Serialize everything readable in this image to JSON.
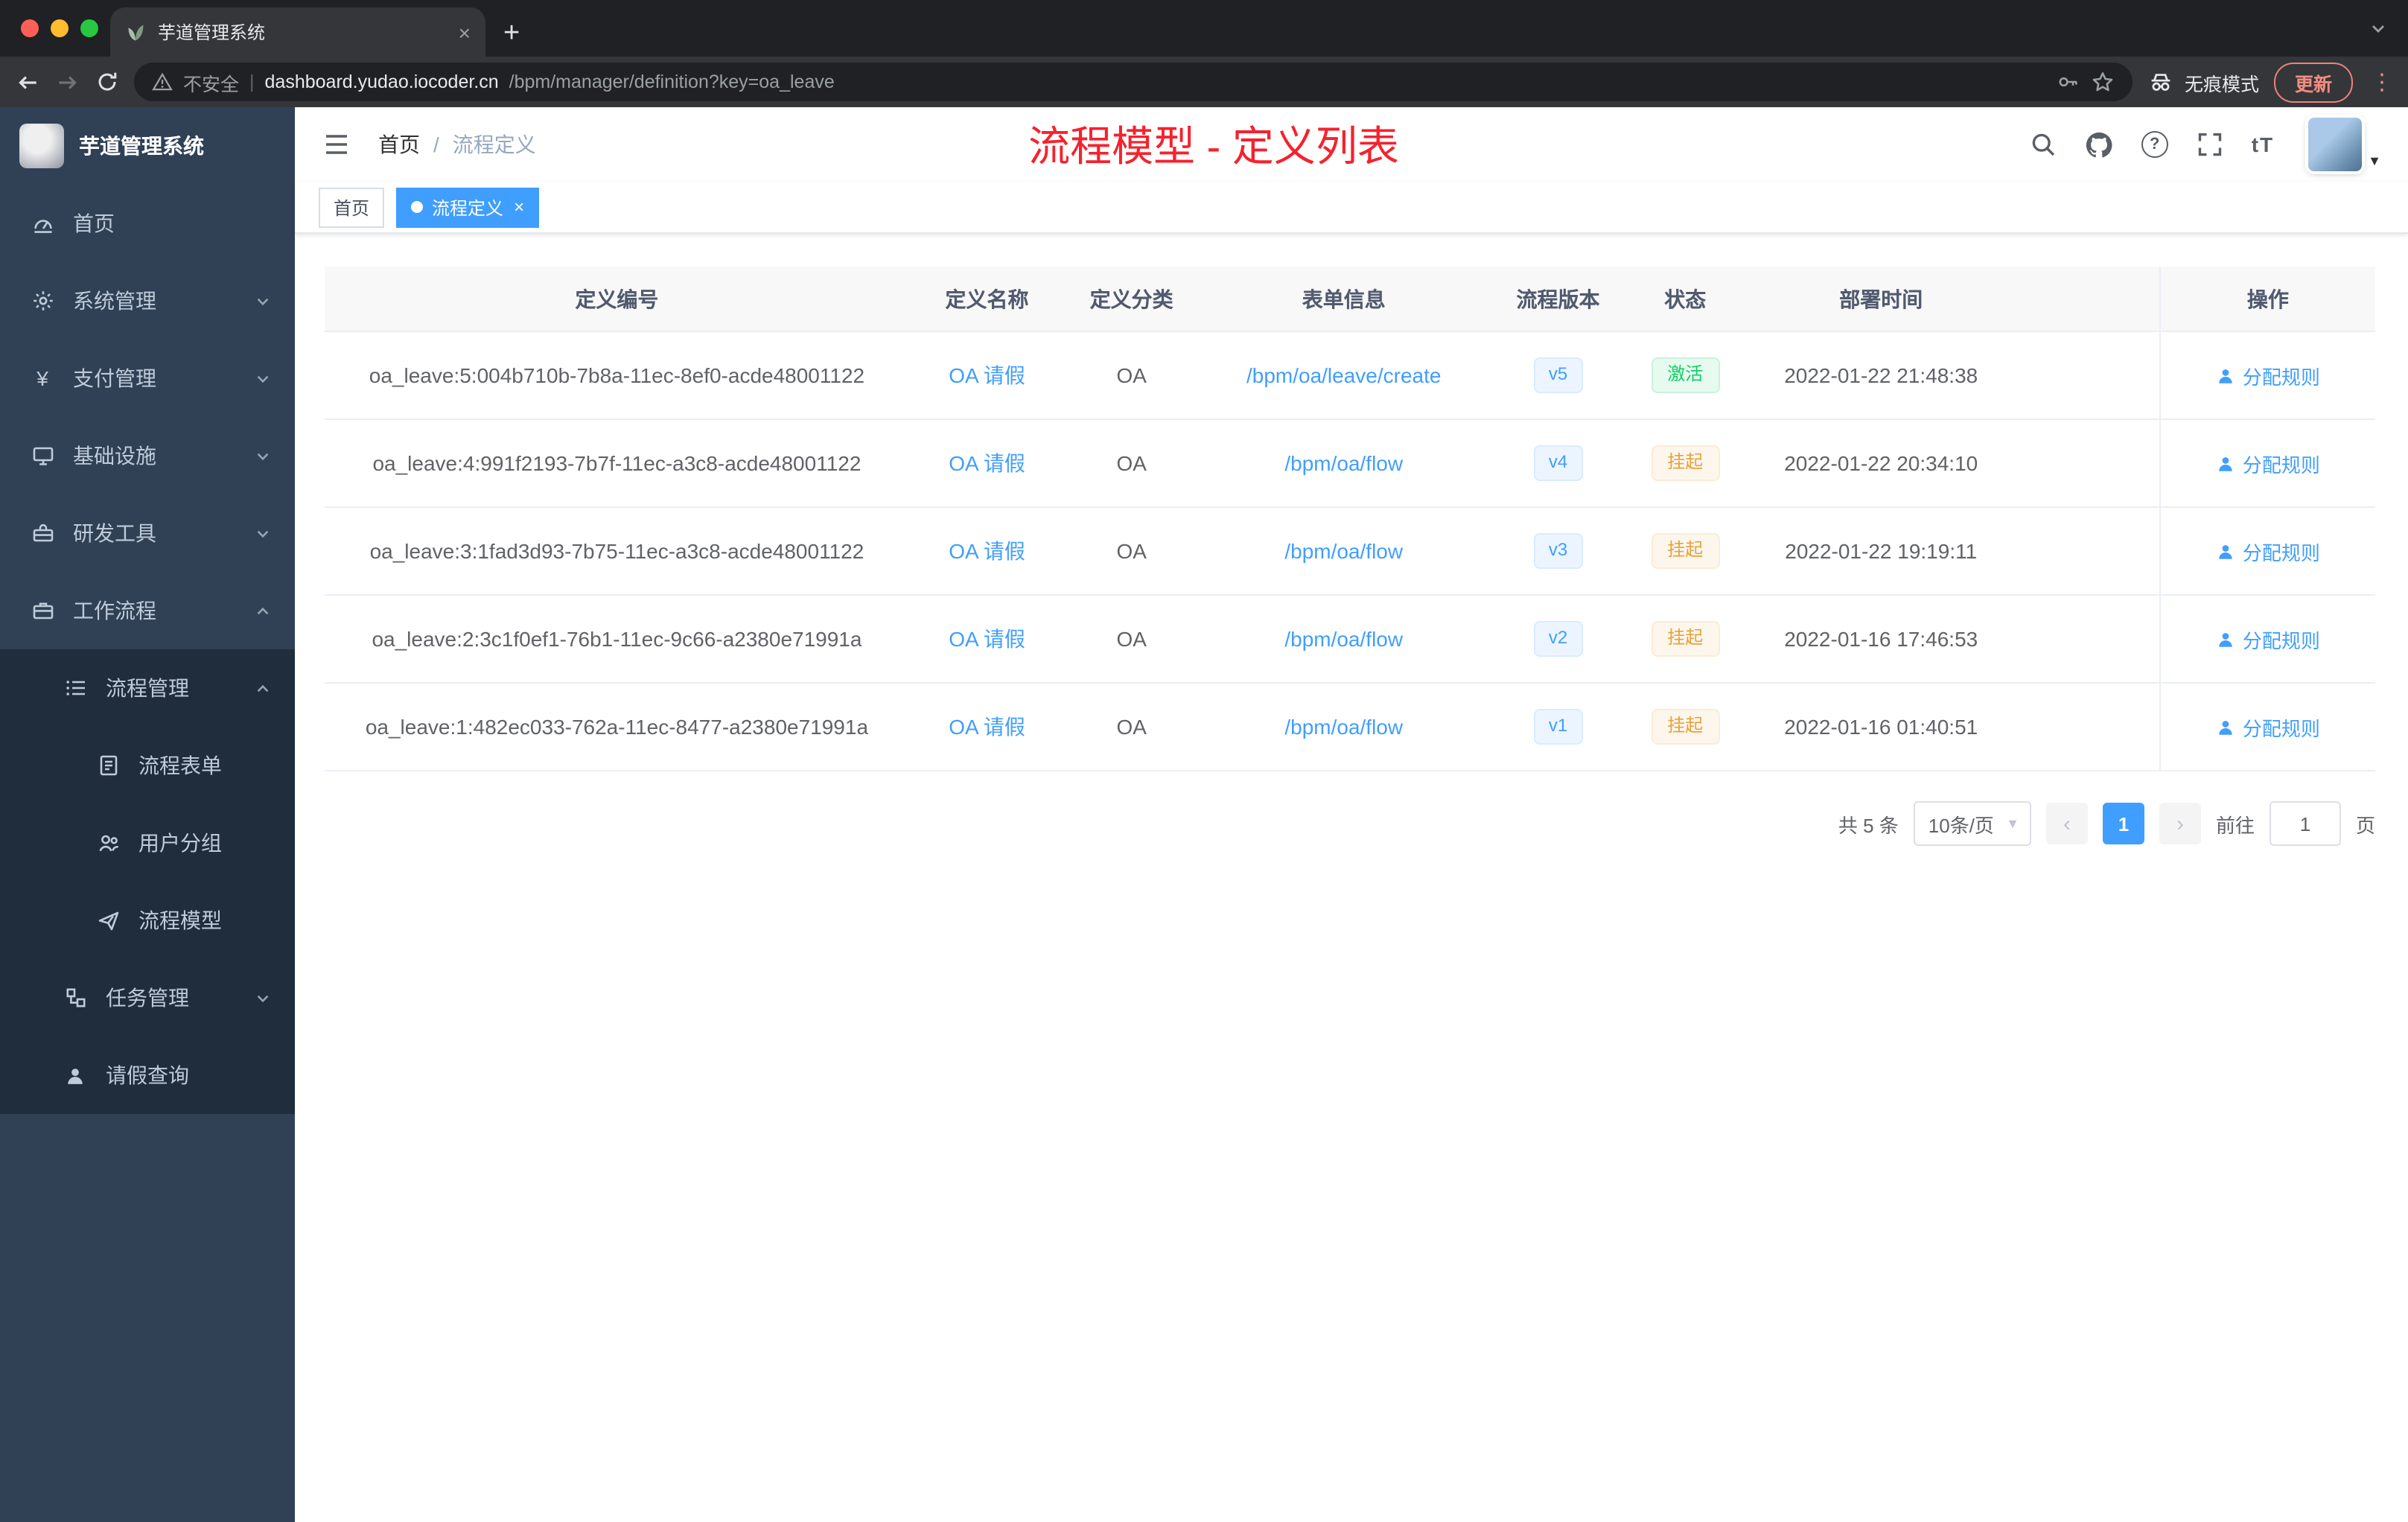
{
  "browser": {
    "tab_title": "芋道管理系统",
    "security_label": "不安全",
    "url_host": "dashboard.yudao.iocoder.cn",
    "url_path": "/bpm/manager/definition?key=oa_leave",
    "incognito_label": "无痕模式",
    "update_label": "更新"
  },
  "sidebar": {
    "logo_title": "芋道管理系统",
    "items": [
      {
        "id": "home",
        "label": "首页",
        "icon": "dashboard-icon",
        "level": 1,
        "chevron": "",
        "dark": false
      },
      {
        "id": "system",
        "label": "系统管理",
        "icon": "gear-icon",
        "level": 1,
        "chevron": "down",
        "dark": false
      },
      {
        "id": "payment",
        "label": "支付管理",
        "icon": "yen-icon",
        "level": 1,
        "chevron": "down",
        "dark": false
      },
      {
        "id": "infra",
        "label": "基础设施",
        "icon": "monitor-icon",
        "level": 1,
        "chevron": "down",
        "dark": false
      },
      {
        "id": "devtools",
        "label": "研发工具",
        "icon": "toolbox-icon",
        "level": 1,
        "chevron": "down",
        "dark": false
      },
      {
        "id": "workflow",
        "label": "工作流程",
        "icon": "briefcase-icon",
        "level": 1,
        "chevron": "up",
        "dark": false
      },
      {
        "id": "process-mgmt",
        "label": "流程管理",
        "icon": "list-icon",
        "level": 2,
        "chevron": "up",
        "dark": true
      },
      {
        "id": "process-form",
        "label": "流程表单",
        "icon": "form-icon",
        "level": 3,
        "chevron": "",
        "dark": true
      },
      {
        "id": "user-group",
        "label": "用户分组",
        "icon": "people-icon",
        "level": 3,
        "chevron": "",
        "dark": true
      },
      {
        "id": "process-model",
        "label": "流程模型",
        "icon": "send-icon",
        "level": 3,
        "chevron": "",
        "dark": true
      },
      {
        "id": "task-mgmt",
        "label": "任务管理",
        "icon": "sitemap-icon",
        "level": 2,
        "chevron": "down",
        "dark": true
      },
      {
        "id": "leave-query",
        "label": "请假查询",
        "icon": "user-icon",
        "level": 2,
        "chevron": "",
        "dark": true
      }
    ]
  },
  "header": {
    "breadcrumb_home": "首页",
    "breadcrumb_sep": "/",
    "breadcrumb_current": "流程定义",
    "annotation": "流程模型 - 定义列表",
    "font_size_icon": "tT"
  },
  "tags": {
    "items": [
      {
        "label": "首页",
        "active": false
      },
      {
        "label": "流程定义",
        "active": true
      }
    ]
  },
  "table": {
    "columns": [
      {
        "key": "id",
        "label": "定义编号"
      },
      {
        "key": "name",
        "label": "定义名称"
      },
      {
        "key": "category",
        "label": "定义分类"
      },
      {
        "key": "form",
        "label": "表单信息"
      },
      {
        "key": "version",
        "label": "流程版本"
      },
      {
        "key": "status",
        "label": "状态"
      },
      {
        "key": "deployTime",
        "label": "部署时间"
      },
      {
        "key": "spacer",
        "label": ""
      },
      {
        "key": "action",
        "label": "操作"
      }
    ],
    "action_label": "分配规则",
    "rows": [
      {
        "id": "oa_leave:5:004b710b-7b8a-11ec-8ef0-acde48001122",
        "name": "OA 请假",
        "category": "OA",
        "form": "/bpm/oa/leave/create",
        "version": "v5",
        "status": "激活",
        "status_type": "success",
        "deployTime": "2022-01-22 21:48:38"
      },
      {
        "id": "oa_leave:4:991f2193-7b7f-11ec-a3c8-acde48001122",
        "name": "OA 请假",
        "category": "OA",
        "form": "/bpm/oa/flow",
        "version": "v4",
        "status": "挂起",
        "status_type": "warning",
        "deployTime": "2022-01-22 20:34:10"
      },
      {
        "id": "oa_leave:3:1fad3d93-7b75-11ec-a3c8-acde48001122",
        "name": "OA 请假",
        "category": "OA",
        "form": "/bpm/oa/flow",
        "version": "v3",
        "status": "挂起",
        "status_type": "warning",
        "deployTime": "2022-01-22 19:19:11"
      },
      {
        "id": "oa_leave:2:3c1f0ef1-76b1-11ec-9c66-a2380e71991a",
        "name": "OA 请假",
        "category": "OA",
        "form": "/bpm/oa/flow",
        "version": "v2",
        "status": "挂起",
        "status_type": "warning",
        "deployTime": "2022-01-16 17:46:53"
      },
      {
        "id": "oa_leave:1:482ec033-762a-11ec-8477-a2380e71991a",
        "name": "OA 请假",
        "category": "OA",
        "form": "/bpm/oa/flow",
        "version": "v1",
        "status": "挂起",
        "status_type": "warning",
        "deployTime": "2022-01-16 01:40:51"
      }
    ]
  },
  "pagination": {
    "total_label": "共 5 条",
    "page_size": "10条/页",
    "current_page": "1",
    "goto_label": "前往",
    "goto_value": "1",
    "page_unit": "页"
  },
  "colors": {
    "accent": "#409eff",
    "annotation_red": "#f5222d",
    "success_green": "#13ce66",
    "warning_orange": "#e6a23c",
    "sidebar": "#304156",
    "sidebar_submenu": "#1f2d3d"
  }
}
